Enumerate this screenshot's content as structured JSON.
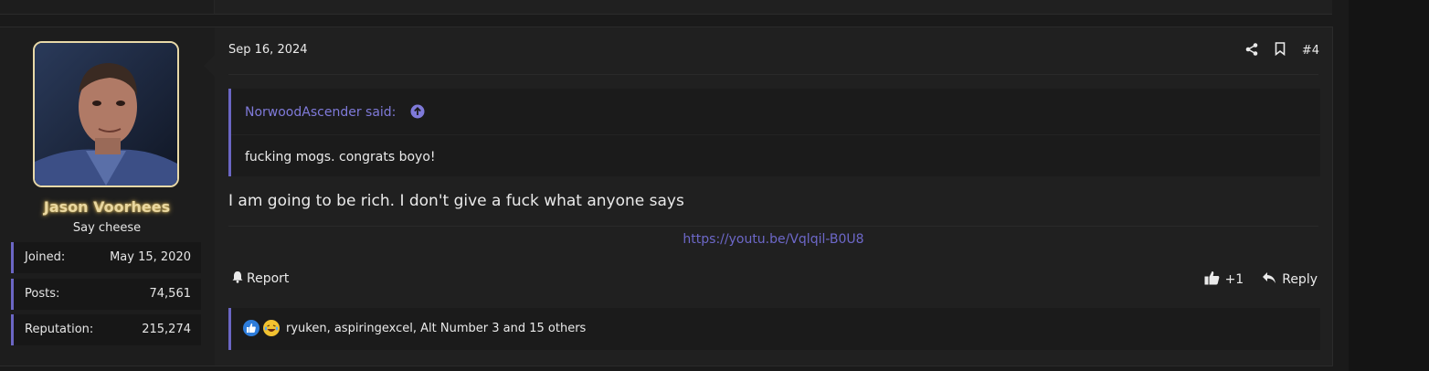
{
  "post": {
    "date": "Sep 16, 2024",
    "number": "#4",
    "user": {
      "name": "Jason Voorhees",
      "title": "Say cheese",
      "stats": [
        {
          "label": "Joined:",
          "value": "May 15, 2020"
        },
        {
          "label": "Posts:",
          "value": "74,561"
        },
        {
          "label": "Reputation:",
          "value": "215,274"
        }
      ]
    },
    "quote": {
      "author_line": "NorwoodAscender said:",
      "text": "fucking mogs. congrats boyo!"
    },
    "message": "I am going to be rich. I don't give a fuck what anyone says",
    "signature_link": "https://youtu.be/Vqlqil-B0U8",
    "actions": {
      "report": "Report",
      "like_count": "+1",
      "reply": "Reply"
    },
    "reactions": {
      "summary": "ryuken, aspiringexcel, Alt Number 3 and 15 others"
    }
  },
  "colors": {
    "accent": "#6b66c4",
    "link": "#6d68c9",
    "username_glow": "#e9d7a0"
  }
}
